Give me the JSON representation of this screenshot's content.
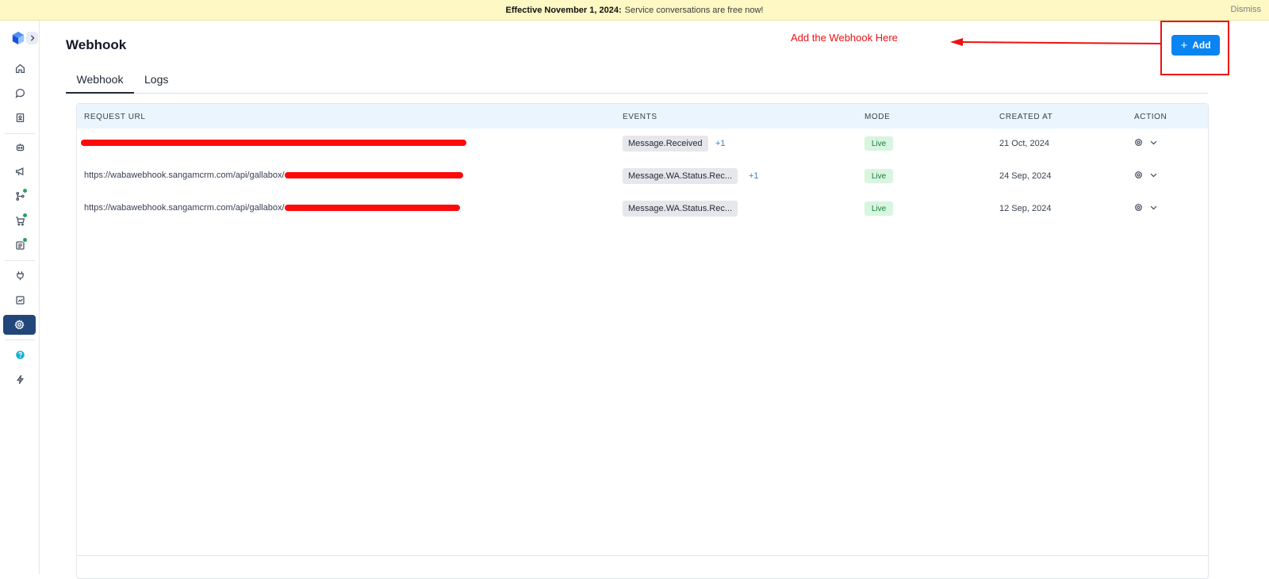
{
  "banner": {
    "bold": "Effective November 1, 2024:",
    "text": "Service conversations are free now!",
    "dismiss": "Dismiss"
  },
  "sidebar": {
    "items": [
      {
        "icon": "home-icon"
      },
      {
        "icon": "chat-icon"
      },
      {
        "icon": "contacts-icon"
      },
      {
        "icon": "bot-icon"
      },
      {
        "icon": "megaphone-icon"
      },
      {
        "icon": "flow-icon",
        "dot": true
      },
      {
        "icon": "cart-icon",
        "dot": true
      },
      {
        "icon": "forms-icon",
        "dot": true
      },
      {
        "icon": "plug-icon"
      },
      {
        "icon": "analytics-icon"
      },
      {
        "icon": "settings-icon",
        "active": true
      },
      {
        "icon": "help-icon"
      },
      {
        "icon": "bolt-icon"
      }
    ]
  },
  "page": {
    "title": "Webhook",
    "annotation": "Add the Webhook Here",
    "add_label": "Add"
  },
  "tabs": [
    {
      "label": "Webhook",
      "active": true
    },
    {
      "label": "Logs"
    }
  ],
  "table": {
    "headers": [
      "REQUEST URL",
      "EVENTS",
      "MODE",
      "CREATED AT",
      "ACTION"
    ],
    "rows": [
      {
        "url": "",
        "event": "Message.Received",
        "extra": "+1",
        "mode": "Live",
        "created": "21 Oct, 2024"
      },
      {
        "url": "https://wabawebhook.sangamcrm.com/api/gallabox/",
        "event": "Message.WA.Status.Rec...",
        "extra": "+1",
        "mode": "Live",
        "created": "24 Sep, 2024"
      },
      {
        "url": "https://wabawebhook.sangamcrm.com/api/gallabox/",
        "event": "Message.WA.Status.Rec...",
        "extra": "",
        "mode": "Live",
        "created": "12 Sep, 2024"
      }
    ]
  },
  "colors": {
    "accent": "#0a84f1",
    "annotation": "#ee1111",
    "banner": "#fdf8c4",
    "sidebar_active": "#23467a"
  }
}
